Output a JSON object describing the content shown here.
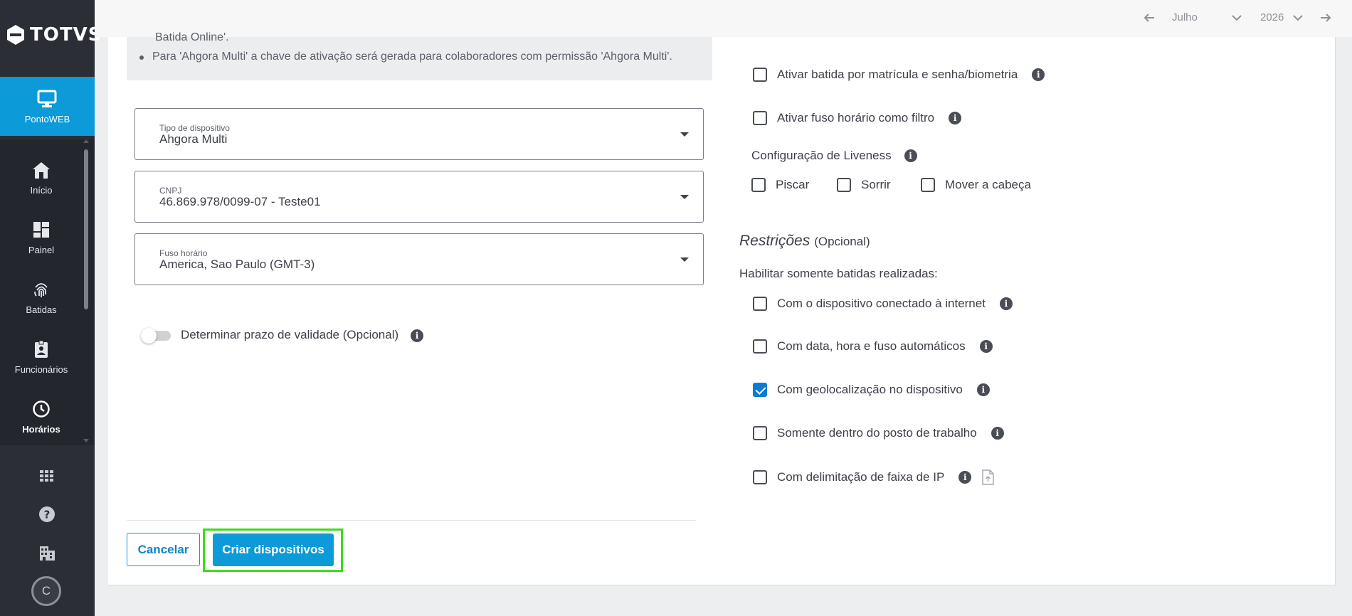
{
  "sidebar": {
    "logo_text": "TOTVS",
    "active_item": {
      "label": "PontoWEB",
      "icon": "monitor-icon"
    },
    "items": [
      {
        "label": "Início",
        "icon": "home-icon"
      },
      {
        "label": "Painel",
        "icon": "dashboard-icon"
      },
      {
        "label": "Batidas",
        "icon": "fingerprint-icon"
      },
      {
        "label": "Funcionários",
        "icon": "badge-icon"
      },
      {
        "label": "Horários",
        "icon": "clock-icon"
      }
    ],
    "bottom_icons": [
      "apps-grid-icon",
      "help-icon",
      "building-icon"
    ],
    "avatar_initial": "C"
  },
  "topbar": {
    "month": "Julho",
    "year": "2026"
  },
  "info_box": {
    "cut_line": "Batida Online'.",
    "bullet": "Para 'Ahgora Multi' a chave de ativação será gerada para colaboradores com permissão 'Ahgora Multi'."
  },
  "form": {
    "device_type": {
      "label": "Tipo de dispositivo",
      "value": "Ahgora Multi"
    },
    "cnpj": {
      "label": "CNPJ",
      "value": "46.869.978/0099-07 - Teste01"
    },
    "timezone": {
      "label": "Fuso horário",
      "value": "America, Sao Paulo (GMT-3)"
    },
    "validity_toggle": {
      "label": "Determinar prazo de validade (Opcional)",
      "on": false
    }
  },
  "options": {
    "batida_matricula": {
      "label": "Ativar batida por matrícula e senha/biometria",
      "checked": false
    },
    "fuso_filtro": {
      "label": "Ativar fuso horário como filtro",
      "checked": false
    },
    "liveness": {
      "title": "Configuração de Liveness",
      "piscar": {
        "label": "Piscar",
        "checked": false
      },
      "sorrir": {
        "label": "Sorrir",
        "checked": false
      },
      "mover": {
        "label": "Mover a cabeça",
        "checked": false
      }
    }
  },
  "restrictions": {
    "title": "Restrições",
    "optional": "(Opcional)",
    "subtitle": "Habilitar somente batidas realizadas:",
    "items": [
      {
        "label": "Com o dispositivo conectado à internet",
        "checked": false
      },
      {
        "label": "Com data, hora e fuso automáticos",
        "checked": false
      },
      {
        "label": "Com geolocalização no dispositivo",
        "checked": true
      },
      {
        "label": "Somente dentro do posto de trabalho",
        "checked": false
      },
      {
        "label": "Com delimitação de faixa de IP",
        "checked": false
      }
    ]
  },
  "actions": {
    "cancel": "Cancelar",
    "create": "Criar dispositivos"
  },
  "colors": {
    "sidebar": "#2c2e36",
    "accent": "#0c9ad8",
    "highlight": "#3ddb1e",
    "checkbox_checked": "#0c7bd4"
  }
}
